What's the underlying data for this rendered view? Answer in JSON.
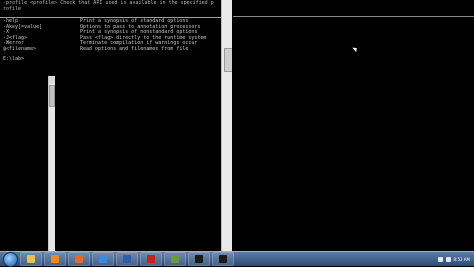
{
  "console": {
    "header_lines": [
      "-profile <profile>        Check that API used is available in the specified p",
      "rofile"
    ],
    "options": [
      {
        "opt": "-help",
        "desc": "Print a synopsis of standard options"
      },
      {
        "opt": "-Akey[=value]",
        "desc": "Options to pass to annotation processors"
      },
      {
        "opt": "-X",
        "desc": "Print a synopsis of nonstandard options"
      },
      {
        "opt": "-J<flag>",
        "desc": "Pass <flag> directly to the runtime system"
      },
      {
        "opt": "-Werror",
        "desc": "Terminate compilation if warnings occur"
      },
      {
        "opt": "@<filename>",
        "desc": "Read options and filenames from file"
      }
    ],
    "prompt": "E:\\lab>"
  },
  "taskbar": {
    "buttons": [
      {
        "name": "explorer-icon",
        "color": "#e8c04a"
      },
      {
        "name": "media-player-icon",
        "color": "#f08a1e"
      },
      {
        "name": "firefox-icon",
        "color": "#e06a2a"
      },
      {
        "name": "ie-icon",
        "color": "#3d8be0"
      },
      {
        "name": "word-icon",
        "color": "#2f5ea8"
      },
      {
        "name": "acrobat-icon",
        "color": "#c8201c"
      },
      {
        "name": "app-icon",
        "color": "#6a9a3a"
      },
      {
        "name": "cmd-icon",
        "color": "#1a1a1a"
      },
      {
        "name": "cmd-icon-2",
        "color": "#1a1a1a"
      }
    ],
    "clock_time": "8:52 AM"
  }
}
